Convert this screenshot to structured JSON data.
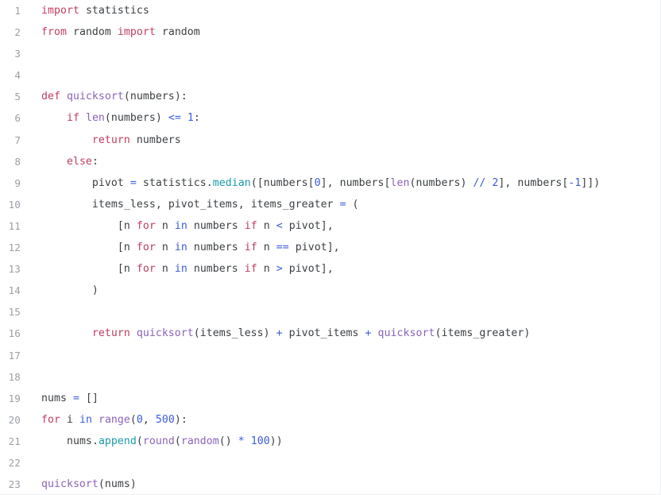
{
  "editor": {
    "name": "python-code-editor",
    "language": "python",
    "background_color": "#ffffff",
    "line_number_color": "#9aa0a6",
    "total_lines": 23,
    "palette": {
      "keyword": "#bf3e5e",
      "operator": "#3b5bdb",
      "number": "#3b5bdb",
      "function": "#8a63b8",
      "method": "#1a9aa8",
      "identifier": "#3c4043"
    },
    "line_numbers": [
      "1",
      "2",
      "3",
      "4",
      "5",
      "6",
      "7",
      "8",
      "9",
      "10",
      "11",
      "12",
      "13",
      "14",
      "15",
      "16",
      "17",
      "18",
      "19",
      "20",
      "21",
      "22",
      "23"
    ],
    "lines": [
      {
        "number": "1",
        "text": "import statistics",
        "tokens": [
          {
            "t": "import",
            "c": "t-kw"
          },
          {
            "t": " ",
            "c": "t-pun"
          },
          {
            "t": "statistics",
            "c": "t-id"
          }
        ]
      },
      {
        "number": "2",
        "text": "from random import random",
        "tokens": [
          {
            "t": "from",
            "c": "t-kw"
          },
          {
            "t": " ",
            "c": "t-pun"
          },
          {
            "t": "random",
            "c": "t-id"
          },
          {
            "t": " ",
            "c": "t-pun"
          },
          {
            "t": "import",
            "c": "t-kw"
          },
          {
            "t": " ",
            "c": "t-pun"
          },
          {
            "t": "random",
            "c": "t-id"
          }
        ]
      },
      {
        "number": "3",
        "text": "",
        "tokens": []
      },
      {
        "number": "4",
        "text": "",
        "tokens": []
      },
      {
        "number": "5",
        "text": "def quicksort(numbers):",
        "tokens": [
          {
            "t": "def",
            "c": "t-kw"
          },
          {
            "t": " ",
            "c": "t-pun"
          },
          {
            "t": "quicksort",
            "c": "t-fn"
          },
          {
            "t": "(",
            "c": "t-pun"
          },
          {
            "t": "numbers",
            "c": "t-id"
          },
          {
            "t": "):",
            "c": "t-pun"
          }
        ]
      },
      {
        "number": "6",
        "text": "    if len(numbers) <= 1:",
        "tokens": [
          {
            "t": "    ",
            "c": "t-pun"
          },
          {
            "t": "if",
            "c": "t-kw"
          },
          {
            "t": " ",
            "c": "t-pun"
          },
          {
            "t": "len",
            "c": "t-fn"
          },
          {
            "t": "(",
            "c": "t-pun"
          },
          {
            "t": "numbers",
            "c": "t-id"
          },
          {
            "t": ") ",
            "c": "t-pun"
          },
          {
            "t": "<=",
            "c": "t-op"
          },
          {
            "t": " ",
            "c": "t-pun"
          },
          {
            "t": "1",
            "c": "t-num"
          },
          {
            "t": ":",
            "c": "t-pun"
          }
        ]
      },
      {
        "number": "7",
        "text": "        return numbers",
        "tokens": [
          {
            "t": "        ",
            "c": "t-pun"
          },
          {
            "t": "return",
            "c": "t-kw"
          },
          {
            "t": " ",
            "c": "t-pun"
          },
          {
            "t": "numbers",
            "c": "t-id"
          }
        ]
      },
      {
        "number": "8",
        "text": "    else:",
        "tokens": [
          {
            "t": "    ",
            "c": "t-pun"
          },
          {
            "t": "else",
            "c": "t-kw"
          },
          {
            "t": ":",
            "c": "t-pun"
          }
        ]
      },
      {
        "number": "9",
        "text": "        pivot = statistics.median([numbers[0], numbers[len(numbers) // 2], numbers[-1]])",
        "tokens": [
          {
            "t": "        ",
            "c": "t-pun"
          },
          {
            "t": "pivot",
            "c": "t-id"
          },
          {
            "t": " ",
            "c": "t-pun"
          },
          {
            "t": "=",
            "c": "t-op"
          },
          {
            "t": " ",
            "c": "t-pun"
          },
          {
            "t": "statistics",
            "c": "t-id"
          },
          {
            "t": ".",
            "c": "t-pun"
          },
          {
            "t": "median",
            "c": "t-meth"
          },
          {
            "t": "([",
            "c": "t-pun"
          },
          {
            "t": "numbers",
            "c": "t-id"
          },
          {
            "t": "[",
            "c": "t-pun"
          },
          {
            "t": "0",
            "c": "t-num"
          },
          {
            "t": "], ",
            "c": "t-pun"
          },
          {
            "t": "numbers",
            "c": "t-id"
          },
          {
            "t": "[",
            "c": "t-pun"
          },
          {
            "t": "len",
            "c": "t-fn"
          },
          {
            "t": "(",
            "c": "t-pun"
          },
          {
            "t": "numbers",
            "c": "t-id"
          },
          {
            "t": ") ",
            "c": "t-pun"
          },
          {
            "t": "//",
            "c": "t-op"
          },
          {
            "t": " ",
            "c": "t-pun"
          },
          {
            "t": "2",
            "c": "t-num"
          },
          {
            "t": "], ",
            "c": "t-pun"
          },
          {
            "t": "numbers",
            "c": "t-id"
          },
          {
            "t": "[",
            "c": "t-pun"
          },
          {
            "t": "-",
            "c": "t-op"
          },
          {
            "t": "1",
            "c": "t-num"
          },
          {
            "t": "]])",
            "c": "t-pun"
          }
        ]
      },
      {
        "number": "10",
        "text": "        items_less, pivot_items, items_greater = (",
        "tokens": [
          {
            "t": "        ",
            "c": "t-pun"
          },
          {
            "t": "items_less",
            "c": "t-id"
          },
          {
            "t": ", ",
            "c": "t-pun"
          },
          {
            "t": "pivot_items",
            "c": "t-id"
          },
          {
            "t": ", ",
            "c": "t-pun"
          },
          {
            "t": "items_greater",
            "c": "t-id"
          },
          {
            "t": " ",
            "c": "t-pun"
          },
          {
            "t": "=",
            "c": "t-op"
          },
          {
            "t": " (",
            "c": "t-pun"
          }
        ]
      },
      {
        "number": "11",
        "text": "            [n for n in numbers if n < pivot],",
        "tokens": [
          {
            "t": "            [",
            "c": "t-pun"
          },
          {
            "t": "n",
            "c": "t-id"
          },
          {
            "t": " ",
            "c": "t-pun"
          },
          {
            "t": "for",
            "c": "t-kw"
          },
          {
            "t": " ",
            "c": "t-pun"
          },
          {
            "t": "n",
            "c": "t-id"
          },
          {
            "t": " ",
            "c": "t-pun"
          },
          {
            "t": "in",
            "c": "t-op"
          },
          {
            "t": " ",
            "c": "t-pun"
          },
          {
            "t": "numbers",
            "c": "t-id"
          },
          {
            "t": " ",
            "c": "t-pun"
          },
          {
            "t": "if",
            "c": "t-kw"
          },
          {
            "t": " ",
            "c": "t-pun"
          },
          {
            "t": "n",
            "c": "t-id"
          },
          {
            "t": " ",
            "c": "t-pun"
          },
          {
            "t": "<",
            "c": "t-op"
          },
          {
            "t": " ",
            "c": "t-pun"
          },
          {
            "t": "pivot",
            "c": "t-id"
          },
          {
            "t": "],",
            "c": "t-pun"
          }
        ]
      },
      {
        "number": "12",
        "text": "            [n for n in numbers if n == pivot],",
        "tokens": [
          {
            "t": "            [",
            "c": "t-pun"
          },
          {
            "t": "n",
            "c": "t-id"
          },
          {
            "t": " ",
            "c": "t-pun"
          },
          {
            "t": "for",
            "c": "t-kw"
          },
          {
            "t": " ",
            "c": "t-pun"
          },
          {
            "t": "n",
            "c": "t-id"
          },
          {
            "t": " ",
            "c": "t-pun"
          },
          {
            "t": "in",
            "c": "t-op"
          },
          {
            "t": " ",
            "c": "t-pun"
          },
          {
            "t": "numbers",
            "c": "t-id"
          },
          {
            "t": " ",
            "c": "t-pun"
          },
          {
            "t": "if",
            "c": "t-kw"
          },
          {
            "t": " ",
            "c": "t-pun"
          },
          {
            "t": "n",
            "c": "t-id"
          },
          {
            "t": " ",
            "c": "t-pun"
          },
          {
            "t": "==",
            "c": "t-op"
          },
          {
            "t": " ",
            "c": "t-pun"
          },
          {
            "t": "pivot",
            "c": "t-id"
          },
          {
            "t": "],",
            "c": "t-pun"
          }
        ]
      },
      {
        "number": "13",
        "text": "            [n for n in numbers if n > pivot],",
        "tokens": [
          {
            "t": "            [",
            "c": "t-pun"
          },
          {
            "t": "n",
            "c": "t-id"
          },
          {
            "t": " ",
            "c": "t-pun"
          },
          {
            "t": "for",
            "c": "t-kw"
          },
          {
            "t": " ",
            "c": "t-pun"
          },
          {
            "t": "n",
            "c": "t-id"
          },
          {
            "t": " ",
            "c": "t-pun"
          },
          {
            "t": "in",
            "c": "t-op"
          },
          {
            "t": " ",
            "c": "t-pun"
          },
          {
            "t": "numbers",
            "c": "t-id"
          },
          {
            "t": " ",
            "c": "t-pun"
          },
          {
            "t": "if",
            "c": "t-kw"
          },
          {
            "t": " ",
            "c": "t-pun"
          },
          {
            "t": "n",
            "c": "t-id"
          },
          {
            "t": " ",
            "c": "t-pun"
          },
          {
            "t": ">",
            "c": "t-op"
          },
          {
            "t": " ",
            "c": "t-pun"
          },
          {
            "t": "pivot",
            "c": "t-id"
          },
          {
            "t": "],",
            "c": "t-pun"
          }
        ]
      },
      {
        "number": "14",
        "text": "        )",
        "tokens": [
          {
            "t": "        )",
            "c": "t-pun"
          }
        ]
      },
      {
        "number": "15",
        "text": "",
        "tokens": []
      },
      {
        "number": "16",
        "text": "        return quicksort(items_less) + pivot_items + quicksort(items_greater)",
        "tokens": [
          {
            "t": "        ",
            "c": "t-pun"
          },
          {
            "t": "return",
            "c": "t-kw"
          },
          {
            "t": " ",
            "c": "t-pun"
          },
          {
            "t": "quicksort",
            "c": "t-fn"
          },
          {
            "t": "(",
            "c": "t-pun"
          },
          {
            "t": "items_less",
            "c": "t-id"
          },
          {
            "t": ") ",
            "c": "t-pun"
          },
          {
            "t": "+",
            "c": "t-op"
          },
          {
            "t": " ",
            "c": "t-pun"
          },
          {
            "t": "pivot_items",
            "c": "t-id"
          },
          {
            "t": " ",
            "c": "t-pun"
          },
          {
            "t": "+",
            "c": "t-op"
          },
          {
            "t": " ",
            "c": "t-pun"
          },
          {
            "t": "quicksort",
            "c": "t-fn"
          },
          {
            "t": "(",
            "c": "t-pun"
          },
          {
            "t": "items_greater",
            "c": "t-id"
          },
          {
            "t": ")",
            "c": "t-pun"
          }
        ]
      },
      {
        "number": "17",
        "text": "",
        "tokens": []
      },
      {
        "number": "18",
        "text": "",
        "tokens": []
      },
      {
        "number": "19",
        "text": "nums = []",
        "tokens": [
          {
            "t": "nums",
            "c": "t-id"
          },
          {
            "t": " ",
            "c": "t-pun"
          },
          {
            "t": "=",
            "c": "t-op"
          },
          {
            "t": " []",
            "c": "t-pun"
          }
        ]
      },
      {
        "number": "20",
        "text": "for i in range(0, 500):",
        "tokens": [
          {
            "t": "for",
            "c": "t-kw"
          },
          {
            "t": " ",
            "c": "t-pun"
          },
          {
            "t": "i",
            "c": "t-id"
          },
          {
            "t": " ",
            "c": "t-pun"
          },
          {
            "t": "in",
            "c": "t-op"
          },
          {
            "t": " ",
            "c": "t-pun"
          },
          {
            "t": "range",
            "c": "t-fn"
          },
          {
            "t": "(",
            "c": "t-pun"
          },
          {
            "t": "0",
            "c": "t-num"
          },
          {
            "t": ", ",
            "c": "t-pun"
          },
          {
            "t": "500",
            "c": "t-num"
          },
          {
            "t": "):",
            "c": "t-pun"
          }
        ]
      },
      {
        "number": "21",
        "text": "    nums.append(round(random() * 100))",
        "tokens": [
          {
            "t": "    ",
            "c": "t-pun"
          },
          {
            "t": "nums",
            "c": "t-id"
          },
          {
            "t": ".",
            "c": "t-pun"
          },
          {
            "t": "append",
            "c": "t-meth"
          },
          {
            "t": "(",
            "c": "t-pun"
          },
          {
            "t": "round",
            "c": "t-fn"
          },
          {
            "t": "(",
            "c": "t-pun"
          },
          {
            "t": "random",
            "c": "t-fn"
          },
          {
            "t": "() ",
            "c": "t-pun"
          },
          {
            "t": "*",
            "c": "t-op"
          },
          {
            "t": " ",
            "c": "t-pun"
          },
          {
            "t": "100",
            "c": "t-num"
          },
          {
            "t": "))",
            "c": "t-pun"
          }
        ]
      },
      {
        "number": "22",
        "text": "",
        "tokens": []
      },
      {
        "number": "23",
        "text": "quicksort(nums)",
        "tokens": [
          {
            "t": "quicksort",
            "c": "t-fn"
          },
          {
            "t": "(",
            "c": "t-pun"
          },
          {
            "t": "nums",
            "c": "t-id"
          },
          {
            "t": ")",
            "c": "t-pun"
          }
        ]
      }
    ]
  }
}
